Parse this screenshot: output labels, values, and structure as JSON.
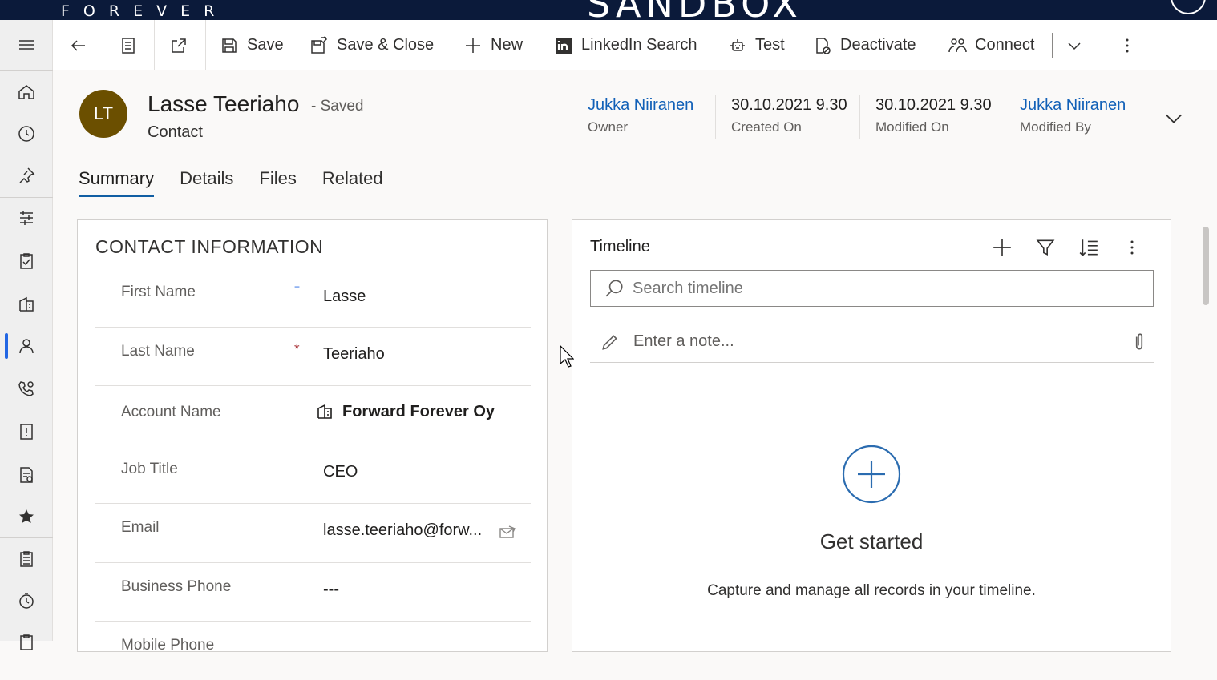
{
  "topbar": {
    "brand": "FOREVER",
    "environment": "SANDBOX"
  },
  "nav": {
    "icons": [
      "menu-icon",
      "home-icon",
      "recent-icon",
      "pin-icon",
      "activities-icon",
      "tasks-icon",
      "accounts-icon",
      "contacts-icon",
      "calls-icon",
      "cases-icon",
      "reports-icon",
      "favorites-icon",
      "documents-icon",
      "timer-icon",
      "clipboard-icon"
    ]
  },
  "commands": {
    "save": "Save",
    "save_close": "Save & Close",
    "new": "New",
    "linkedin": "LinkedIn Search",
    "test": "Test",
    "deactivate": "Deactivate",
    "connect": "Connect"
  },
  "record": {
    "initials": "LT",
    "name": "Lasse Teeriaho",
    "status": "- Saved",
    "type": "Contact"
  },
  "header_fields": [
    {
      "value": "Jukka Niiranen",
      "label": "Owner"
    },
    {
      "value": "30.10.2021 9.30",
      "label": "Created On"
    },
    {
      "value": "30.10.2021 9.30",
      "label": "Modified On"
    },
    {
      "value": "Jukka Niiranen",
      "label": "Modified By"
    }
  ],
  "tabs": [
    "Summary",
    "Details",
    "Files",
    "Related"
  ],
  "contact_info": {
    "title": "CONTACT INFORMATION",
    "fields": [
      {
        "label": "First Name",
        "req": "+",
        "value": "Lasse"
      },
      {
        "label": "Last Name",
        "req": "*",
        "value": "Teeriaho"
      },
      {
        "label": "Account Name",
        "req": "",
        "value": "Forward Forever Oy"
      },
      {
        "label": "Job Title",
        "req": "",
        "value": "CEO"
      },
      {
        "label": "Email",
        "req": "",
        "value": "lasse.teeriaho@forw..."
      },
      {
        "label": "Business Phone",
        "req": "",
        "value": "---"
      },
      {
        "label": "Mobile Phone",
        "req": "",
        "value": ""
      }
    ]
  },
  "timeline": {
    "title": "Timeline",
    "search_placeholder": "Search timeline",
    "note_placeholder": "Enter a note...",
    "get_started": "Get started",
    "description": "Capture and manage all records in your timeline."
  },
  "colors": {
    "topbar": "#0b1a3a",
    "accent": "#115ea3",
    "link": "#1160b7",
    "avatar": "#6b4f00",
    "required": "#a4262c"
  }
}
